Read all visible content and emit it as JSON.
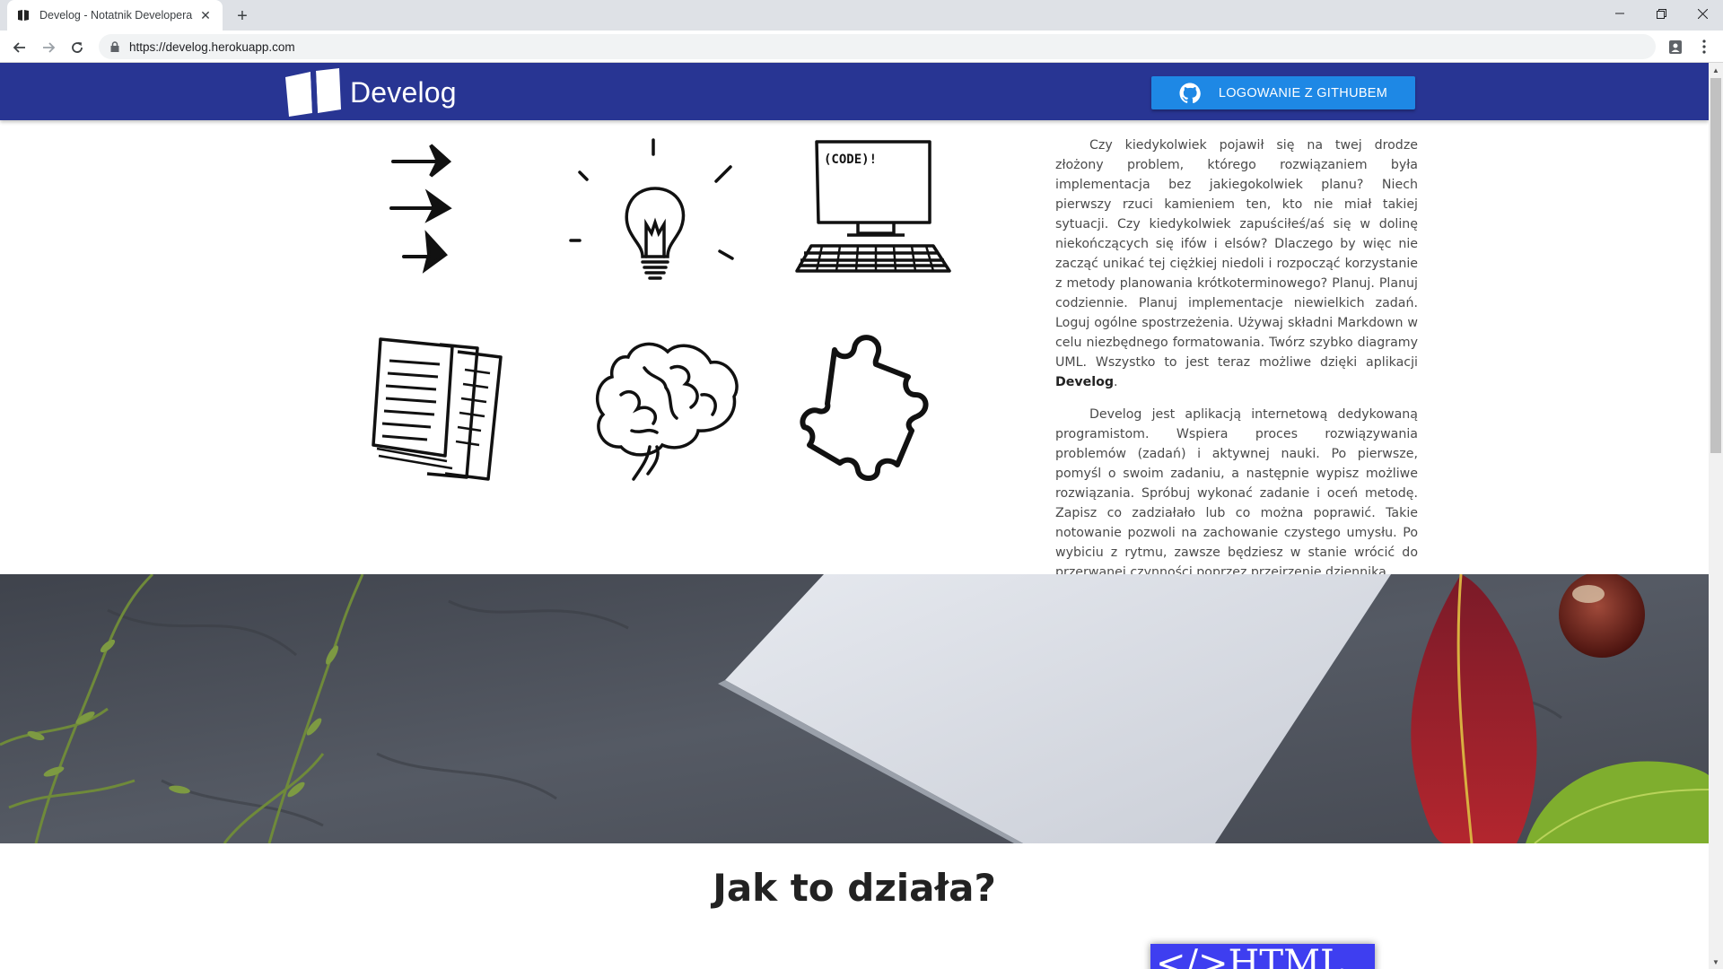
{
  "browser": {
    "tab_title": "Develog - Notatnik Developera",
    "url": "https://develog.herokuapp.com"
  },
  "header": {
    "brand": "Develog",
    "login_label": "LOGOWANIE Z GITHUBEM"
  },
  "illustrations": [
    {
      "name": "arrows-icon"
    },
    {
      "name": "lightbulb-icon"
    },
    {
      "name": "computer-icon",
      "screen_text": "(CODE)!"
    },
    {
      "name": "documents-icon"
    },
    {
      "name": "brain-icon"
    },
    {
      "name": "puzzle-icon"
    }
  ],
  "intro": {
    "p1": "Czy kiedykolwiek pojawił się na twej drodze złożony problem, którego rozwiązaniem była implementacja bez jakiegokolwiek planu? Niech pierwszy rzuci kamieniem ten, kto nie miał takiej sytuacji. Czy kiedykolwiek zapuściłeś/aś się w dolinę niekończących się ifów i elsów? Dlaczego by więc nie zacząć unikać tej ciężkiej niedoli i rozpocząć korzystanie z metody planowania krótkoterminowego? Planuj. Planuj codziennie. Planuj implementacje niewielkich zadań. Loguj ogólne spostrzeżenia. Używaj składni Markdown w celu niezbędnego formatowania. Twórz szybko diagramy UML. Wszystko to jest teraz możliwe dzięki aplikacji",
    "p1_brand": "Develog",
    "p1_end": ".",
    "p2": "Develog jest aplikacją internetową dedykowaną programistom. Wspiera proces rozwiązywania problemów (zadań) i aktywnej nauki. Po pierwsze, pomyśl o swoim zadaniu, a następnie wypisz możliwe rozwiązania. Spróbuj wykonać zadanie i oceń metodę. Zapisz co zadziałało lub co można poprawić. Takie notowanie pozwoli na zachowanie czystego umysłu. Po wybiciu z rytmu, zawsze będziesz w stanie wrócić do przerwanej czynności poprzez przejrzenie dziennika."
  },
  "how_it_works": {
    "title": "Jak to działa?",
    "badge": "</>HTML"
  },
  "colors": {
    "header_bg": "#283593",
    "button_bg": "#1e88e5",
    "badge_bg": "#3e3ef0"
  }
}
